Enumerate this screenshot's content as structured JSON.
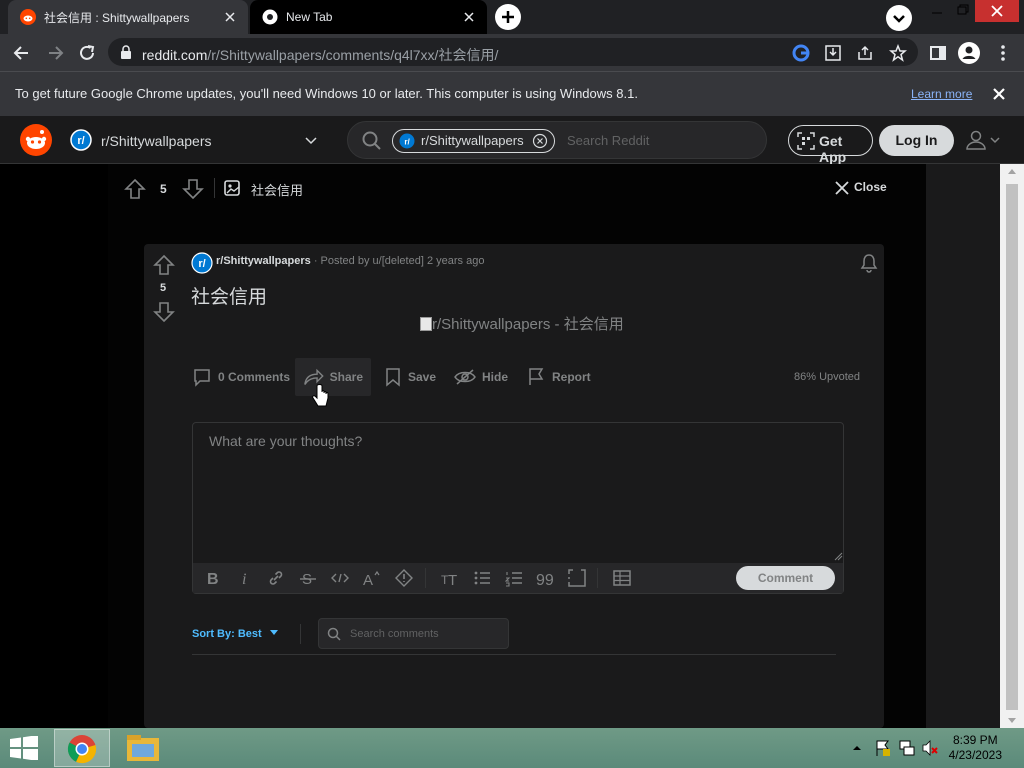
{
  "browser": {
    "tabs": [
      {
        "title": "社会信用 : Shittywallpapers",
        "active": true
      },
      {
        "title": "New Tab",
        "active": false
      }
    ],
    "url_domain": "reddit.com",
    "url_path": "/r/Shittywallpapers/comments/q4l7xx/社会信用/",
    "infobar": {
      "message": "To get future Google Chrome updates, you'll need Windows 10 or later. This computer is using Windows 8.1.",
      "link": "Learn more"
    }
  },
  "reddit_header": {
    "community": "r/Shittywallpapers",
    "search_chip": "r/Shittywallpapers",
    "search_placeholder": "Search Reddit",
    "get_app": "Get App",
    "log_in": "Log In"
  },
  "overlay_bar": {
    "votes": "5",
    "title": "社会信用",
    "close": "Close"
  },
  "post": {
    "subreddit": "r/Shittywallpapers",
    "posted_by": "· Posted by u/[deleted] 2 years ago",
    "votes": "5",
    "title": "社会信用",
    "image_alt": "r/Shittywallpapers - 社会信用",
    "actions": {
      "comments": "0 Comments",
      "share": "Share",
      "save": "Save",
      "hide": "Hide",
      "report": "Report"
    },
    "upvoted": "86% Upvoted"
  },
  "comment_box": {
    "placeholder": "What are your thoughts?",
    "submit": "Comment"
  },
  "sort": {
    "label": "Sort By: Best",
    "search_placeholder": "Search comments"
  },
  "taskbar": {
    "time": "8:39 PM",
    "date": "4/23/2023"
  },
  "colors": {
    "reddit_orange": "#ff4500",
    "link_blue": "#4fbcff",
    "card_bg": "#1a1a1b"
  }
}
